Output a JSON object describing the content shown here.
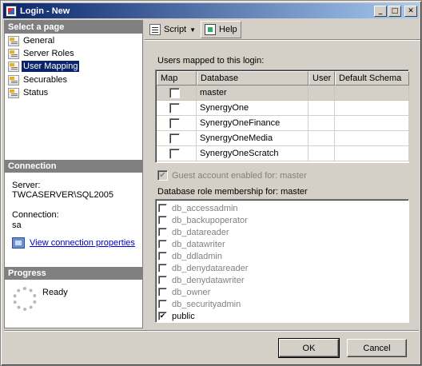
{
  "window": {
    "title": "Login - New"
  },
  "title_buttons": {
    "minimize": "_",
    "maximize": "□",
    "close": "✕"
  },
  "left": {
    "select_page_header": "Select a page",
    "pages": [
      {
        "label": "General"
      },
      {
        "label": "Server Roles"
      },
      {
        "label": "User Mapping",
        "selected": true
      },
      {
        "label": "Securables"
      },
      {
        "label": "Status"
      }
    ],
    "connection_header": "Connection",
    "server_label": "Server:",
    "server_value": "TWCASERVER\\SQL2005",
    "connection_label": "Connection:",
    "connection_value": "sa",
    "view_connection_link": "View connection properties",
    "progress_header": "Progress",
    "progress_status": "Ready"
  },
  "toolbar": {
    "script_label": "Script",
    "help_label": "Help"
  },
  "mapping": {
    "label": "Users mapped to this login:",
    "columns": [
      "Map",
      "Database",
      "User",
      "Default Schema"
    ],
    "rows": [
      {
        "database": "master",
        "user": "",
        "schema": "",
        "mapped": false
      },
      {
        "database": "SynergyOne",
        "user": "",
        "schema": "",
        "mapped": false
      },
      {
        "database": "SynergyOneFinance",
        "user": "",
        "schema": "",
        "mapped": false
      },
      {
        "database": "SynergyOneMedia",
        "user": "",
        "schema": "",
        "mapped": false
      },
      {
        "database": "SynergyOneScratch",
        "user": "",
        "schema": "",
        "mapped": false
      }
    ]
  },
  "guest": {
    "label": "Guest account enabled for: master",
    "checked": true
  },
  "roles": {
    "label": "Database role membership for: master",
    "items": [
      {
        "name": "db_accessadmin",
        "checked": false
      },
      {
        "name": "db_backupoperator",
        "checked": false
      },
      {
        "name": "db_datareader",
        "checked": false
      },
      {
        "name": "db_datawriter",
        "checked": false
      },
      {
        "name": "db_ddladmin",
        "checked": false
      },
      {
        "name": "db_denydatareader",
        "checked": false
      },
      {
        "name": "db_denydatawriter",
        "checked": false
      },
      {
        "name": "db_owner",
        "checked": false
      },
      {
        "name": "db_securityadmin",
        "checked": false
      },
      {
        "name": "public",
        "checked": true
      }
    ]
  },
  "buttons": {
    "ok": "OK",
    "cancel": "Cancel"
  }
}
